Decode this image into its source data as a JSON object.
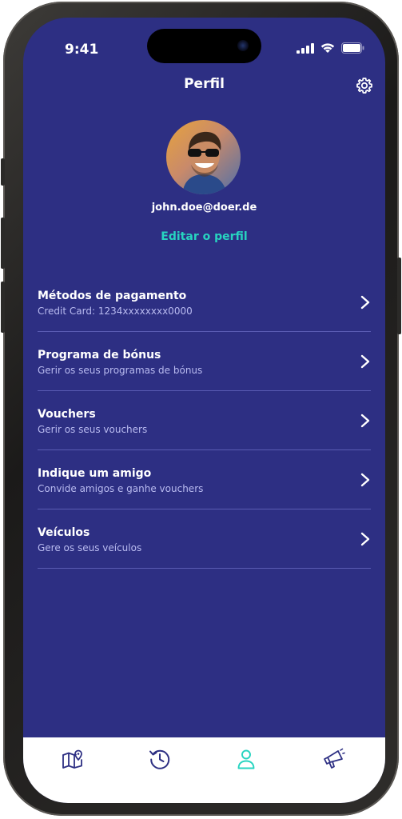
{
  "status_bar": {
    "time": "9:41"
  },
  "header": {
    "title": "Perfil",
    "settings_icon": "gear-icon"
  },
  "profile": {
    "email": "john.doe@doer.de",
    "edit_label": "Editar o perfil"
  },
  "menu": {
    "items": [
      {
        "title": "Métodos de pagamento",
        "subtitle": "Credit Card: 1234xxxxxxxx0000"
      },
      {
        "title": "Programa de bónus",
        "subtitle": "Gerir os seus programas de bónus"
      },
      {
        "title": "Vouchers",
        "subtitle": "Gerir os seus vouchers"
      },
      {
        "title": "Indique um amigo",
        "subtitle": "Convide amigos e ganhe vouchers"
      },
      {
        "title": "Veículos",
        "subtitle": "Gere os seus veículos"
      }
    ]
  },
  "tab_bar": {
    "tabs": [
      {
        "icon": "map-pin-icon",
        "active": false
      },
      {
        "icon": "history-icon",
        "active": false
      },
      {
        "icon": "profile-icon",
        "active": true
      },
      {
        "icon": "megaphone-icon",
        "active": false
      }
    ]
  },
  "colors": {
    "background": "#2d2f83",
    "accent": "#27d4c0",
    "subtitle": "#b9bbf0",
    "divider": "#5a5cb3",
    "tab_icon": "#2d2f83"
  }
}
